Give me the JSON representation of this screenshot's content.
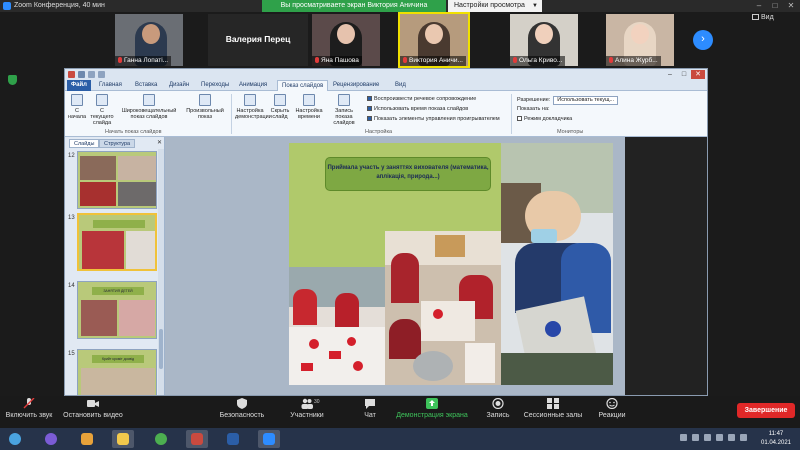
{
  "zoom_window": {
    "title": "Zoom Конференция, 40 мин",
    "share_banner": "Вы просматриваете экран Виктория Аничина",
    "view_options": "Настройки просмотра",
    "view_button": "Вид"
  },
  "participants": [
    {
      "name": "Ганна Лопаті..."
    },
    {
      "name": "Валерия Перец"
    },
    {
      "name": "Яна Пашова"
    },
    {
      "name": "Виктория Аничи..."
    },
    {
      "name": "Ольга Криво..."
    },
    {
      "name": "Алина Журб..."
    }
  ],
  "powerpoint": {
    "tabs": [
      "Файл",
      "Главная",
      "Вставка",
      "Дизайн",
      "Переходы",
      "Анимация",
      "Показ слайдов",
      "Рецензирование",
      "Вид"
    ],
    "ribbon_buttons": [
      {
        "label": "С начала"
      },
      {
        "label": "С текущего слайда"
      },
      {
        "label": "Широковещательный показ слайдов"
      },
      {
        "label": "Произвольный показ"
      },
      {
        "label": "Настройка демонстрации"
      },
      {
        "label": "Скрыть слайд"
      },
      {
        "label": "Настройка времени"
      },
      {
        "label": "Запись показа слайдов"
      }
    ],
    "ribbon_groups": [
      "Начать показ слайдов",
      "Настройка",
      "Мониторы"
    ],
    "checkboxes": [
      {
        "label": "Воспроизвести речевое сопровождение",
        "checked": true
      },
      {
        "label": "Использовать время показа слайдов",
        "checked": true
      },
      {
        "label": "Показать элементы управления проигрывателем",
        "checked": true
      }
    ],
    "monitor": {
      "resolution_label": "Разрешение:",
      "resolution_value": "Использовать текущ...",
      "show_on_label": "Показать на:",
      "presenter_view_label": "Режим докладчика",
      "presenter_view_checked": false
    },
    "pane_tabs": [
      "Слайды",
      "Структура"
    ],
    "slide_numbers": [
      "12",
      "13",
      "14",
      "15"
    ],
    "selected_slide": "13",
    "thumb_labels": [
      "",
      "",
      "ЗАНЯТИЯ ДЕТЕЙ",
      "Крийт кроміт досвід"
    ],
    "slide_title": "Приймала участь у заняттях вихователя (математика, аплікація, природа...)"
  },
  "zoom_controls": [
    {
      "label": "Включить звук"
    },
    {
      "label": "Остановить видео"
    },
    {
      "label": "Безопасность"
    },
    {
      "label": "Участники",
      "count": "30"
    },
    {
      "label": "Чат"
    },
    {
      "label": "Демонстрация экрана"
    },
    {
      "label": "Запись"
    },
    {
      "label": "Сессионные залы"
    },
    {
      "label": "Реакции"
    }
  ],
  "end_button": "Завершение",
  "clock": {
    "time": "11:47",
    "date": "01.04.2021"
  },
  "colors": {
    "zoom_blue": "#2d8cff",
    "share_green": "#2fa14a",
    "end_red": "#e02828",
    "slide_bg": "#b0c96b"
  }
}
